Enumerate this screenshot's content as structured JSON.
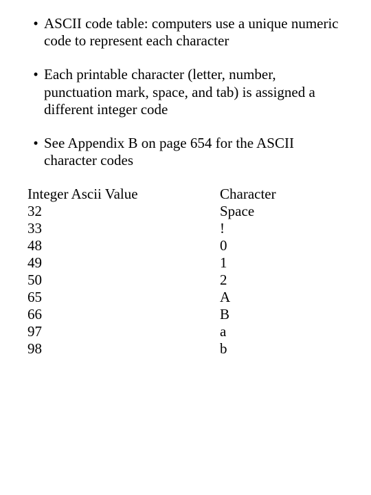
{
  "bullets": [
    "ASCII code table: computers use a unique numeric code to represent each character",
    "Each printable character (letter, number, punctuation mark, space, and tab) is assigned a different integer code",
    "See Appendix B on page 654 for the ASCII character codes"
  ],
  "table": {
    "header_left": "Integer Ascii Value",
    "header_right": "Character",
    "rows": [
      {
        "code": "32",
        "char": "Space"
      },
      {
        "code": "33",
        "char": "!"
      },
      {
        "code": "48",
        "char": "0"
      },
      {
        "code": "49",
        "char": "1"
      },
      {
        "code": "50",
        "char": "2"
      },
      {
        "code": "65",
        "char": "A"
      },
      {
        "code": "66",
        "char": "B"
      },
      {
        "code": "97",
        "char": "a"
      },
      {
        "code": "98",
        "char": "b"
      }
    ]
  }
}
